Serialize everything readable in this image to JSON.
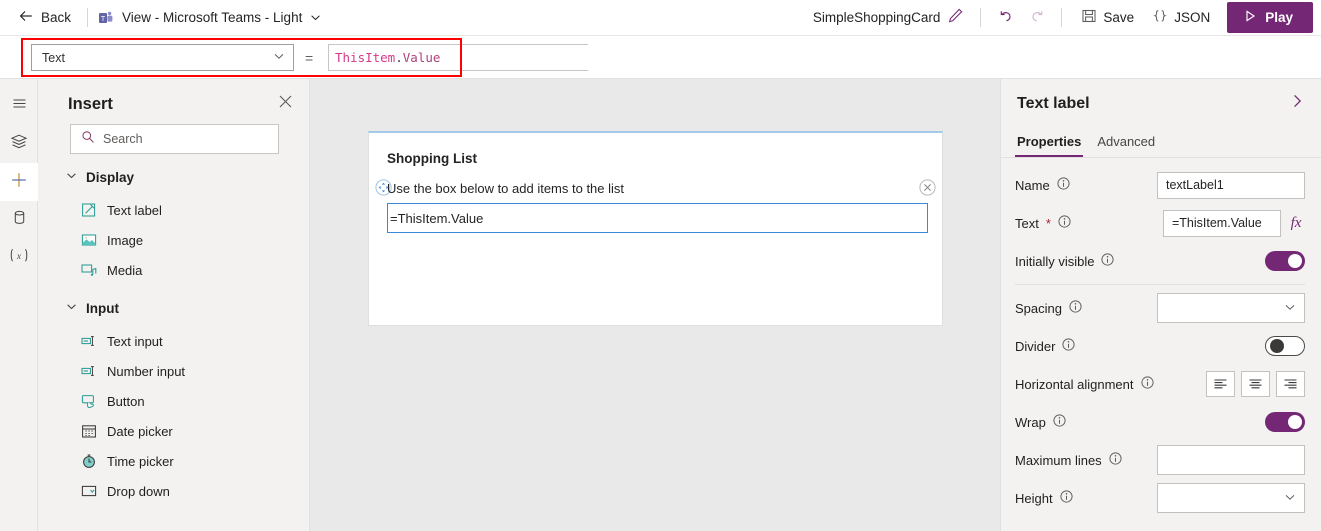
{
  "topbar": {
    "back_label": "Back",
    "back_icon": "arrow-left-icon",
    "app_switcher_label": "View - Microsoft Teams - Light",
    "app_icon": "microsoft-teams-icon",
    "app_switcher_chevron": "chevron-down-icon",
    "app_name": "SimpleShoppingCard",
    "rename_icon": "pencil-icon",
    "undo_icon": "undo-icon",
    "redo_icon": "redo-icon",
    "save_label": "Save",
    "save_icon": "floppy-disk-icon",
    "json_label": "JSON",
    "json_icon": "curly-braces-icon",
    "play_label": "Play",
    "play_icon": "play-triangle-icon",
    "accent_color": "#742774"
  },
  "formula_bar": {
    "property_value": "Text",
    "property_chevron": "chevron-down-icon",
    "equals": "=",
    "formula_token_1": "ThisItem",
    "formula_token_dot": ".",
    "formula_token_2": "Value",
    "highlight_color": "#ff0000"
  },
  "rail": {
    "items": [
      {
        "name": "hamburger-menu-icon",
        "label": "Menu",
        "active": false
      },
      {
        "name": "tree-view-icon",
        "label": "Tree view",
        "active": false
      },
      {
        "name": "plus-icon",
        "label": "Insert",
        "active": true
      },
      {
        "name": "data-icon",
        "label": "Data",
        "active": false
      },
      {
        "name": "variables-icon",
        "label": "Variables",
        "active": false
      }
    ]
  },
  "insert": {
    "title": "Insert",
    "close_icon": "close-icon",
    "search_placeholder": "Search",
    "search_icon": "search-icon",
    "groups": [
      {
        "label": "Display",
        "chevron": "chevron-down-icon",
        "items": [
          {
            "label": "Text label",
            "icon": "text-label-icon"
          },
          {
            "label": "Image",
            "icon": "image-icon"
          },
          {
            "label": "Media",
            "icon": "media-icon"
          }
        ]
      },
      {
        "label": "Input",
        "chevron": "chevron-down-icon",
        "items": [
          {
            "label": "Text input",
            "icon": "text-input-icon"
          },
          {
            "label": "Number input",
            "icon": "number-input-icon"
          },
          {
            "label": "Button",
            "icon": "button-icon"
          },
          {
            "label": "Date picker",
            "icon": "calendar-icon"
          },
          {
            "label": "Time picker",
            "icon": "clock-icon"
          },
          {
            "label": "Drop down",
            "icon": "dropdown-icon"
          }
        ]
      }
    ]
  },
  "canvas": {
    "card_title": "Shopping List",
    "card_subtitle": "Use the box below to add items to the list",
    "move_handle_icon": "move-handle-icon",
    "remove_icon": "circle-close-icon",
    "input_value": "=ThisItem.Value"
  },
  "right_panel": {
    "title": "Text label",
    "collapse_icon": "chevron-right-icon",
    "tabs": [
      {
        "label": "Properties",
        "active": true
      },
      {
        "label": "Advanced",
        "active": false
      }
    ],
    "info_icon": "info-circle-icon",
    "fields": [
      {
        "label": "Name",
        "type": "text",
        "value": "textLabel1",
        "required": false
      },
      {
        "label": "Text",
        "type": "text",
        "value": "=ThisItem.Value",
        "required": true,
        "fx_icon": "fx-icon"
      },
      {
        "label": "Initially visible",
        "type": "toggle",
        "value": "on"
      },
      {
        "label": "Spacing",
        "type": "select",
        "value": ""
      },
      {
        "label": "Divider",
        "type": "toggle",
        "value": "off"
      },
      {
        "label": "Horizontal alignment",
        "type": "align",
        "options": [
          "align-left-icon",
          "align-center-icon",
          "align-right-icon"
        ]
      },
      {
        "label": "Wrap",
        "type": "toggle",
        "value": "on"
      },
      {
        "label": "Maximum lines",
        "type": "text",
        "value": ""
      },
      {
        "label": "Height",
        "type": "select",
        "value": ""
      }
    ]
  }
}
